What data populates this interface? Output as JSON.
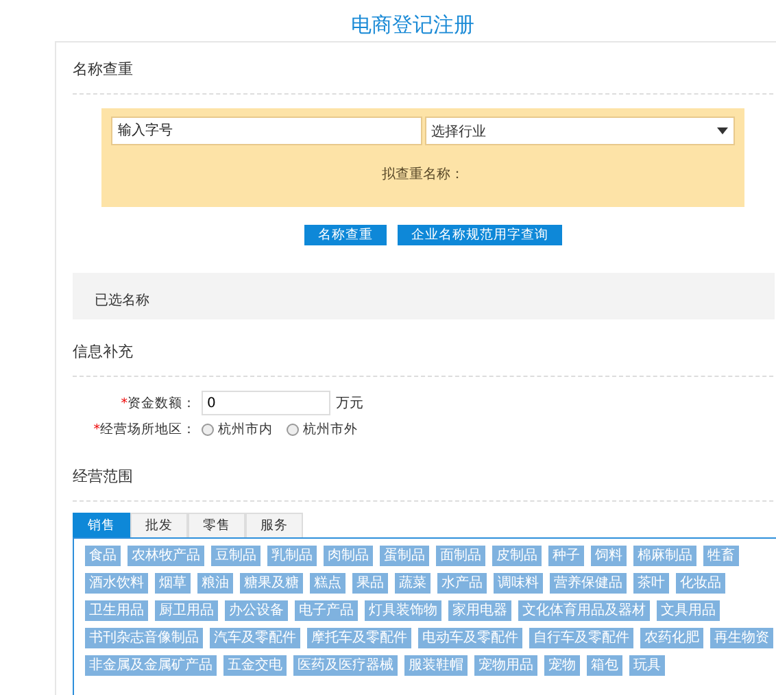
{
  "title": "电商登记注册",
  "name_check": {
    "heading": "名称查重",
    "highlighted": true,
    "name_field": {
      "placeholder": "输入字号"
    },
    "industry_select": {
      "value": "选择行业"
    },
    "preview_label": "拟查重名称：",
    "buttons": [
      {
        "label": "名称查重"
      },
      {
        "label": "企业名称规范用字查询"
      }
    ],
    "selected_names": {
      "label": "已选名称"
    }
  },
  "info": {
    "heading": "信息补充",
    "capital": {
      "required_mark": "*",
      "label": "资金数额：",
      "value": "0",
      "unit": "万元"
    },
    "region": {
      "required_mark": "*",
      "label": "经营场所地区：",
      "options": [
        {
          "label": "杭州市内",
          "selected": false
        },
        {
          "label": "杭州市外",
          "selected": false
        }
      ]
    }
  },
  "scope": {
    "heading": "经营范围",
    "tabs": [
      {
        "label": "销售",
        "selected": true
      },
      {
        "label": "批发",
        "selected": false
      },
      {
        "label": "零售",
        "selected": false
      },
      {
        "label": "服务",
        "selected": false
      }
    ],
    "tag_rows": [
      [
        "食品",
        "农林牧产品",
        "豆制品",
        "乳制品",
        "肉制品",
        "蛋制品",
        "面制品",
        "皮制品",
        "种子",
        "饲料",
        "棉麻制品",
        "牲畜"
      ],
      [
        "酒水饮料",
        "烟草",
        "粮油",
        "糖果及糖",
        "糕点",
        "果品",
        "蔬菜",
        "水产品",
        "调味料",
        "营养保健品",
        "茶叶",
        "化妆品"
      ],
      [
        "卫生用品",
        "厨卫用品",
        "办公设备",
        "电子产品",
        "灯具装饰物",
        "家用电器",
        "文化体育用品及器材",
        "文具用品"
      ],
      [
        "书刊杂志音像制品",
        "汽车及零配件",
        "摩托车及零配件",
        "电动车及零配件",
        "自行车及零配件",
        "农药化肥",
        "再生物资"
      ],
      [
        "非金属及金属矿产品",
        "五金交电",
        "医药及医疗器械",
        "服装鞋帽",
        "宠物用品",
        "宠物",
        "箱包",
        "玩具"
      ]
    ]
  }
}
